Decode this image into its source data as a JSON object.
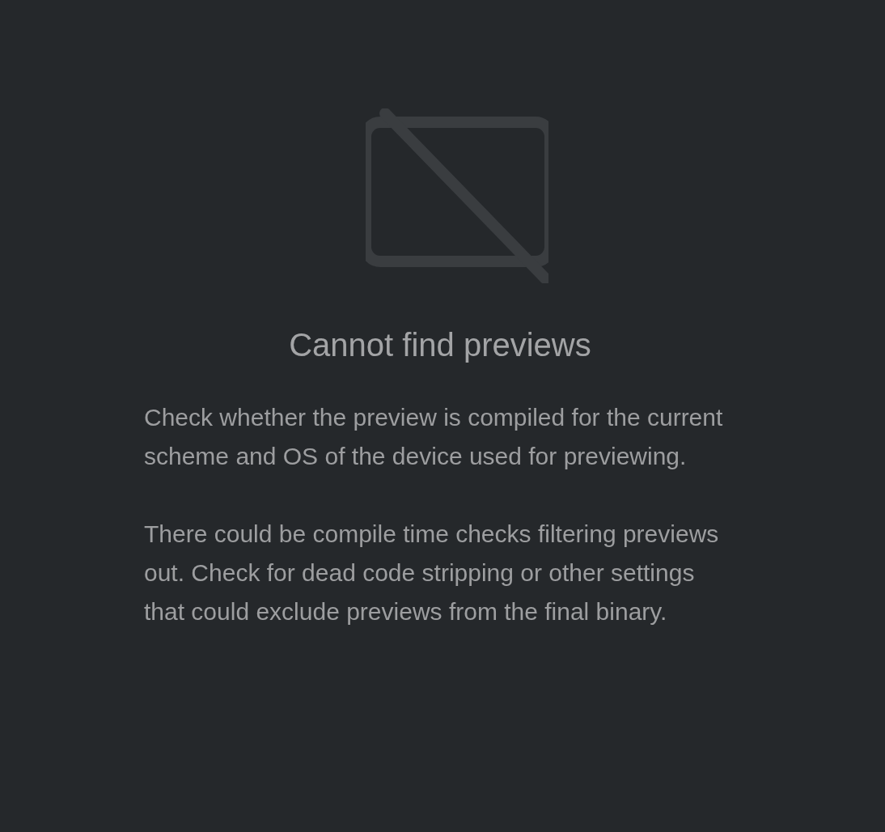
{
  "empty_state": {
    "title": "Cannot find previews",
    "paragraphs": [
      "Check whether the preview is compiled for the current scheme and OS of the device used for previewing.",
      "There could be compile time checks filtering previews out. Check for dead code stripping or other settings that could exclude previews from the final binary."
    ]
  }
}
